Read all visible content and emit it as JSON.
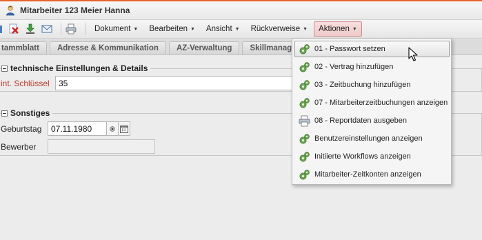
{
  "window": {
    "title": "Mitarbeiter 123 Meier Hanna",
    "accent_color": "#e8622c"
  },
  "toolbar": {
    "icons": [
      "edit-icon",
      "delete-icon",
      "download-icon",
      "email-icon",
      "print-icon"
    ],
    "menus": [
      {
        "label": "Dokument"
      },
      {
        "label": "Bearbeiten"
      },
      {
        "label": "Ansicht"
      },
      {
        "label": "Rückverweise"
      },
      {
        "label": "Aktionen",
        "active": true
      }
    ]
  },
  "tabs": [
    {
      "label": "tammblatt"
    },
    {
      "label": "Adresse & Kommunikation"
    },
    {
      "label": "AZ-Verwaltung"
    },
    {
      "label": "Skillmanagemen"
    }
  ],
  "sections": {
    "technical": {
      "legend": "technische Einstellungen & Details",
      "key_label": "int. Schlüssel",
      "key_value": "35"
    },
    "misc": {
      "legend": "Sonstiges",
      "birthday_label": "Geburtstag",
      "birthday_value": "07.11.1980",
      "applicant_label": "Bewerber",
      "applicant_value": ""
    }
  },
  "actions_menu": {
    "items": [
      {
        "label": "01 - Passwort setzen",
        "icon": "gears-icon",
        "hovered": true
      },
      {
        "label": "02 - Vertrag hinzufügen",
        "icon": "gears-icon"
      },
      {
        "label": "03 - Zeitbuchung hinzufügen",
        "icon": "gears-icon"
      },
      {
        "label": "07 - Mitarbeiterzeitbuchungen anzeigen",
        "icon": "gears-icon"
      },
      {
        "label": "08 - Reportdaten ausgeben",
        "icon": "printer-icon"
      },
      {
        "label": "Benutzereinstellungen anzeigen",
        "icon": "gears-icon"
      },
      {
        "label": "Initiierte Workflows anzeigen",
        "icon": "gears-icon"
      },
      {
        "label": "Mitarbeiter-Zeitkonten anzeigen",
        "icon": "gears-icon"
      }
    ]
  },
  "colors": {
    "menu_active_bg": "#efc9c9",
    "required_label": "#c0392b"
  }
}
